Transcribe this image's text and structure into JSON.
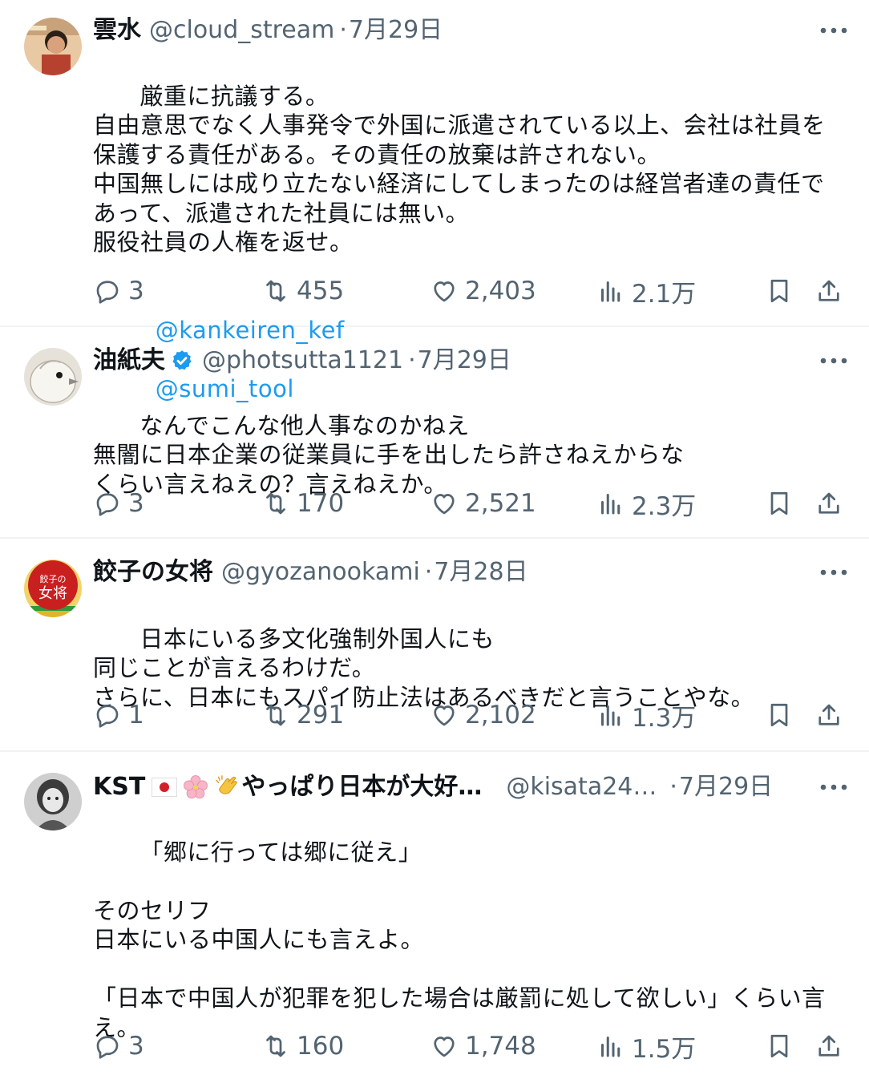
{
  "tweets": [
    {
      "name": "雲水",
      "handle": "@cloud_stream",
      "dot": "·",
      "date": "7月29日",
      "body": "厳重に抗議する。\n自由意思でなく人事発令で外国に派遣されている以上、会社は社員を\n保護する責任がある。その責任の放棄は許されない。\n中国無しには成り立たない経済にしてしまったのは経営者達の責任で\nあって、派遣された社員には無い。\n服役社員の人権を返せ。",
      "mentions": [
        "@kankeiren_kef",
        "@sumi_tool"
      ],
      "replies": "3",
      "reposts": "455",
      "likes": "2,403",
      "views": "2.1万",
      "avatar_icon": "portrait-avatar-icon"
    },
    {
      "name": "油紙夫",
      "handle": "@photsutta1121",
      "dot": "·",
      "date": "7月29日",
      "body": "なんでこんな他人事なのかねえ\n無闇に日本企業の従業員に手を出したら許さねえからな\nくらい言えねえの？言えねえか。",
      "replies": "3",
      "reposts": "170",
      "likes": "2,521",
      "views": "2.3万",
      "avatar_icon": "bird-avatar-icon",
      "verified": true
    },
    {
      "name": "餃子の女将",
      "handle": "@gyozanookami",
      "dot": "·",
      "date": "7月28日",
      "body": "日本にいる多文化強制外国人にも\n同じことが言えるわけだ。\nさらに、日本にもスパイ防止法はあるべきだと言うことやな。",
      "replies": "1",
      "reposts": "291",
      "likes": "2,102",
      "views": "1.3万",
      "avatar_icon": "gyoza-logo-avatar-icon",
      "avatar_text": "餃子の女将"
    },
    {
      "name_prefix": "KST",
      "name_suffix": "やっぱり日本が大好…",
      "handle": "@kisata24…",
      "dot": "·",
      "date": "7月29日",
      "body": "「郷に行っては郷に従え」\n\nそのセリフ\n日本にいる中国人にも言えよ。\n\n「日本で中国人が犯罪を犯した場合は厳罰に処して欲しい」くらい言\nえ。",
      "replies": "3",
      "reposts": "160",
      "likes": "1,748",
      "views": "1.5万",
      "avatar_icon": "sketch-portrait-avatar-icon"
    }
  ],
  "colors": {
    "text": "#0f1419",
    "muted": "#536471",
    "link": "#1d9bf0",
    "verified": "#1d9bf0",
    "divider": "#eff3f4"
  },
  "icons": [
    "reply-icon",
    "repost-icon",
    "like-icon",
    "views-icon",
    "bookmark-icon",
    "share-icon",
    "more-icon",
    "verified-badge-icon"
  ]
}
